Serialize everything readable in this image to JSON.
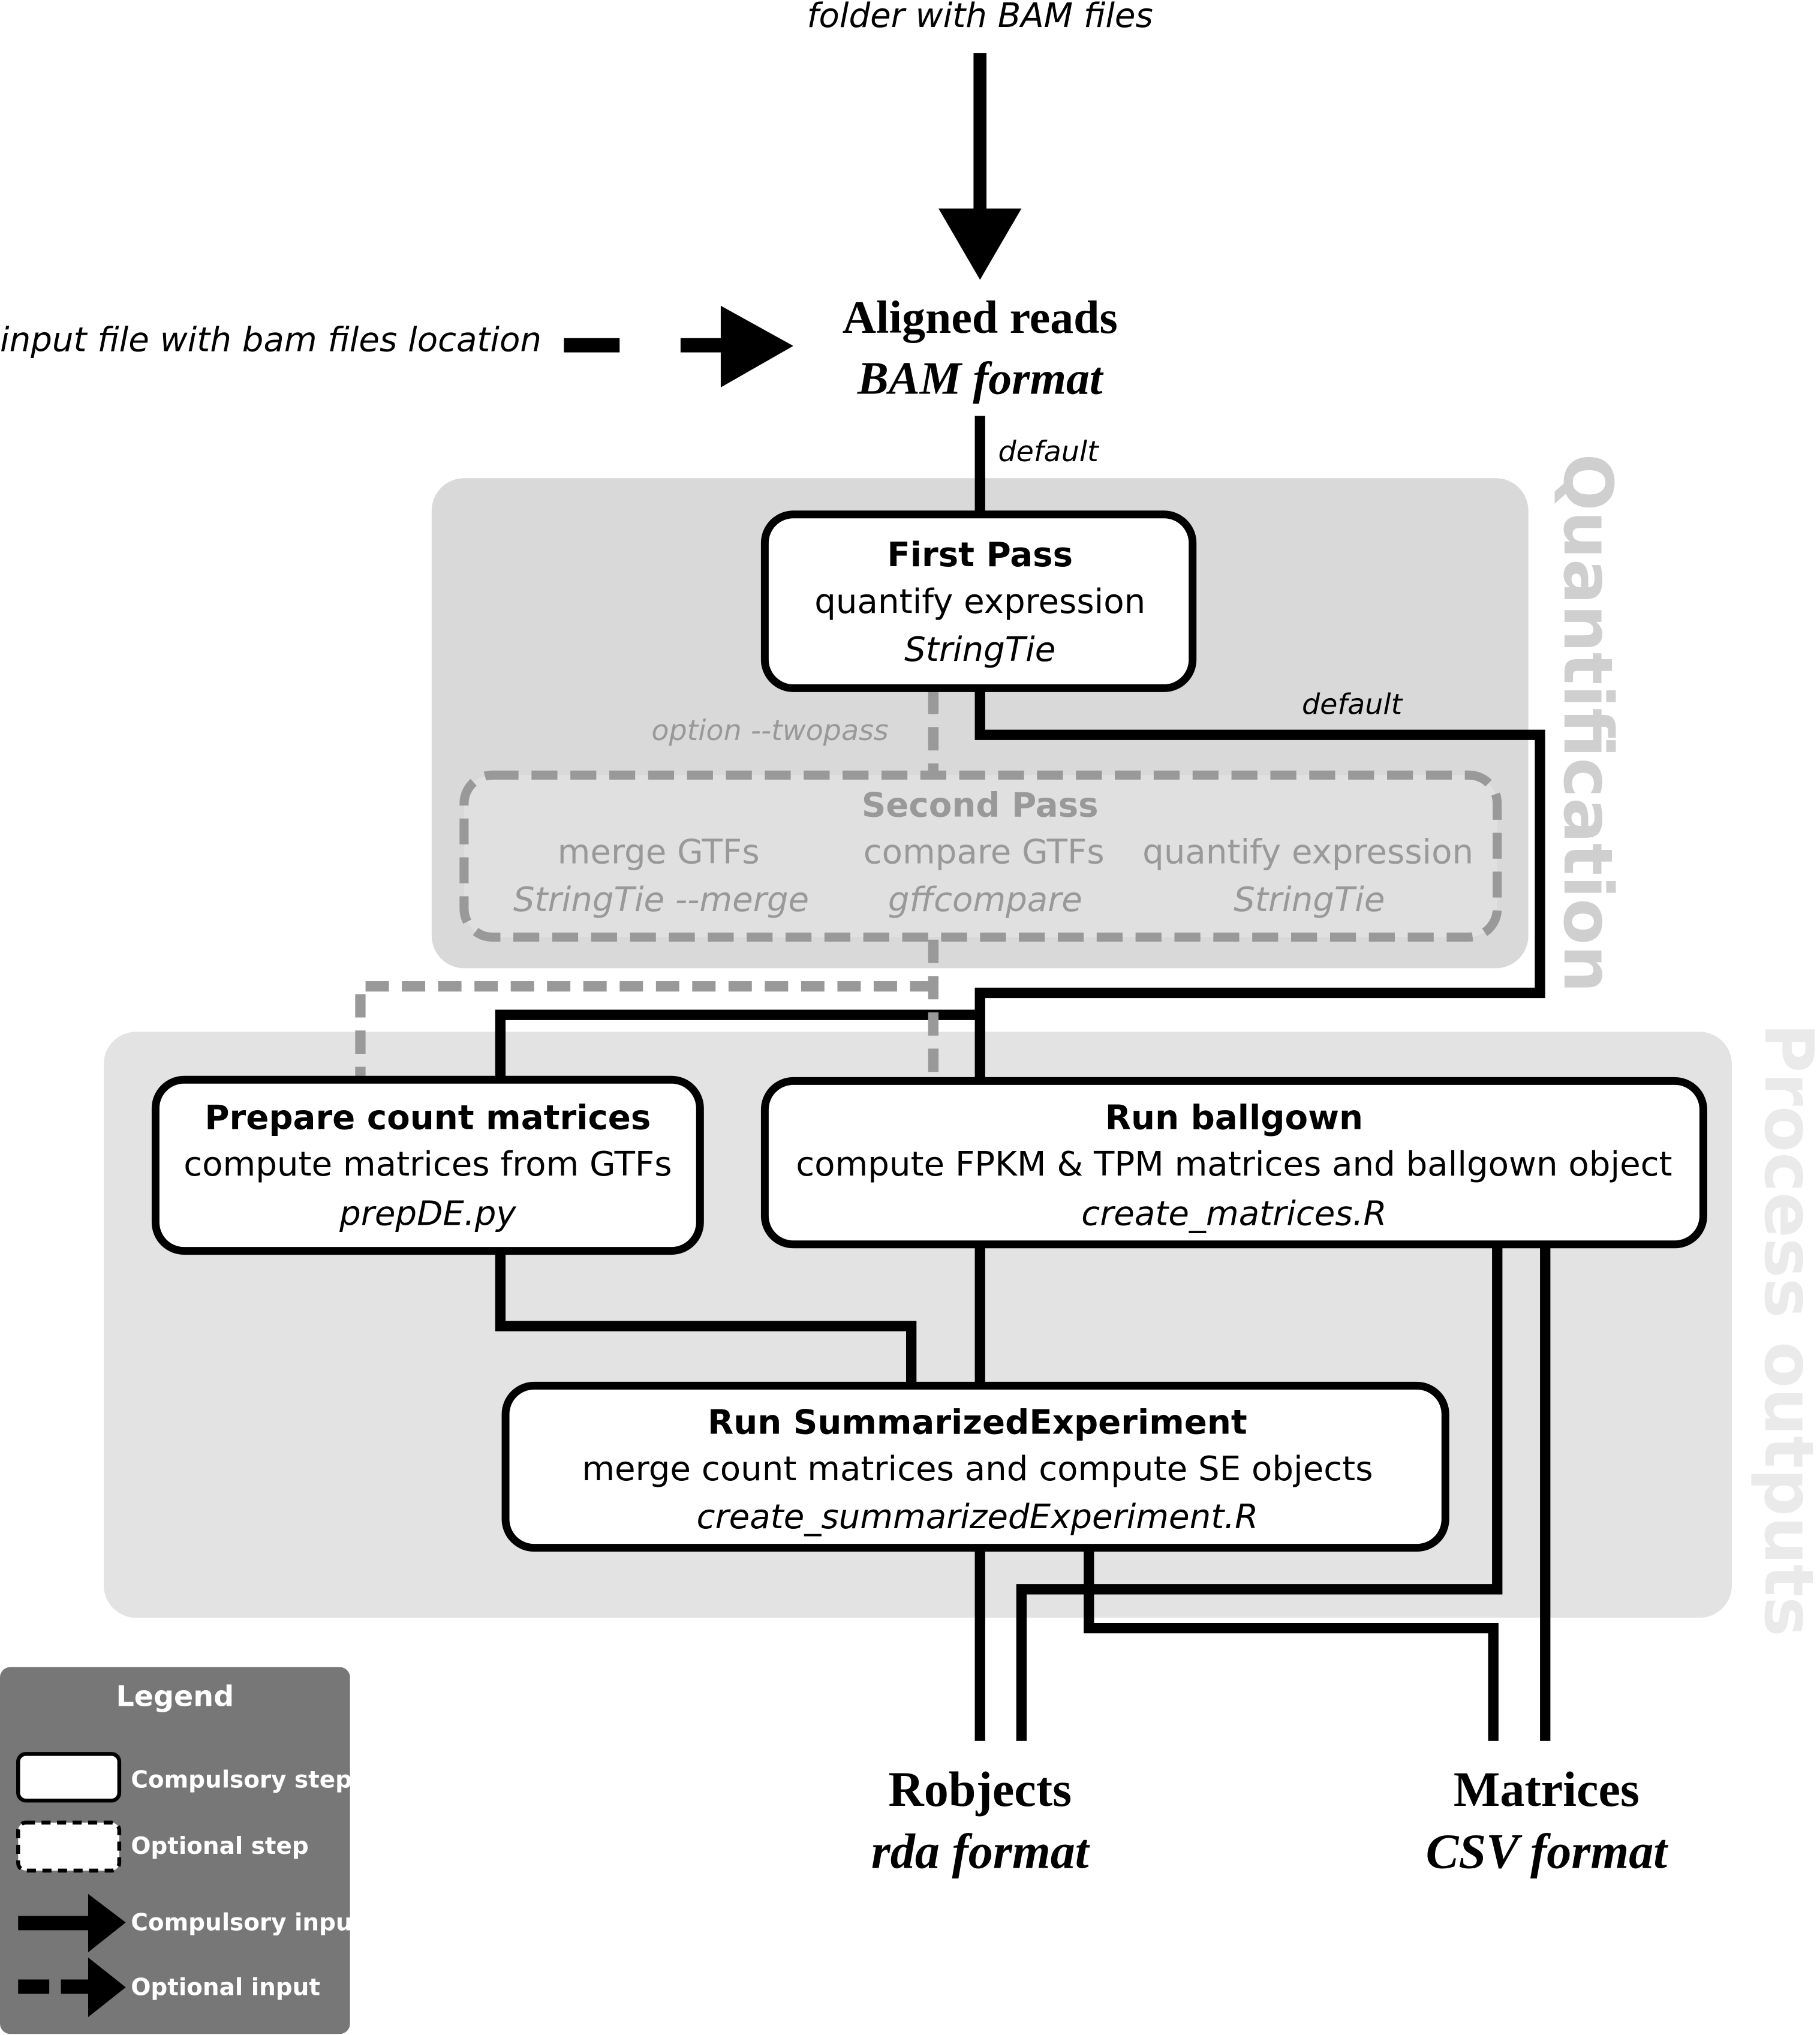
{
  "inputs": {
    "folder": "folder with BAM files",
    "input_file": "input file with bam files location"
  },
  "aligned_reads": {
    "title": "Aligned reads",
    "format": "BAM format"
  },
  "edge_labels": {
    "default_top": "default",
    "default_right": "default",
    "twopass": "option --twopass"
  },
  "groups": {
    "quantification": "Quantification",
    "process_outputs": "Process outputs"
  },
  "first_pass": {
    "title": "First Pass",
    "desc": "quantify expression",
    "tool": "StringTie"
  },
  "second_pass": {
    "title": "Second Pass",
    "steps": [
      {
        "desc": "merge GTFs",
        "tool": "StringTie --merge"
      },
      {
        "desc": "compare GTFs",
        "tool": "gffcompare"
      },
      {
        "desc": "quantify expression",
        "tool": "StringTie"
      }
    ]
  },
  "prepare_counts": {
    "title": "Prepare count matrices",
    "desc": "compute matrices from GTFs",
    "tool": "prepDE.py"
  },
  "ballgown": {
    "title": "Run ballgown",
    "desc": "compute FPKM & TPM matrices and ballgown object",
    "tool": "create_matrices.R"
  },
  "summarized": {
    "title": "Run SummarizedExperiment",
    "desc": "merge count matrices and compute SE objects",
    "tool": "create_summarizedExperiment.R"
  },
  "outputs": {
    "robjects": {
      "title": "Robjects",
      "format": "rda format"
    },
    "matrices": {
      "title": "Matrices",
      "format": "CSV format"
    }
  },
  "legend": {
    "title": "Legend",
    "compulsory_step": "Compulsory step",
    "optional_step": "Optional step",
    "compulsory_input": "Compulsory input",
    "optional_input": "Optional input"
  },
  "colors": {
    "compulsory": "#000000",
    "optional": "#999999",
    "group_bg": "#d9d9d9",
    "group_bg2": "#e3e3e3",
    "legend_bg": "#777777"
  }
}
